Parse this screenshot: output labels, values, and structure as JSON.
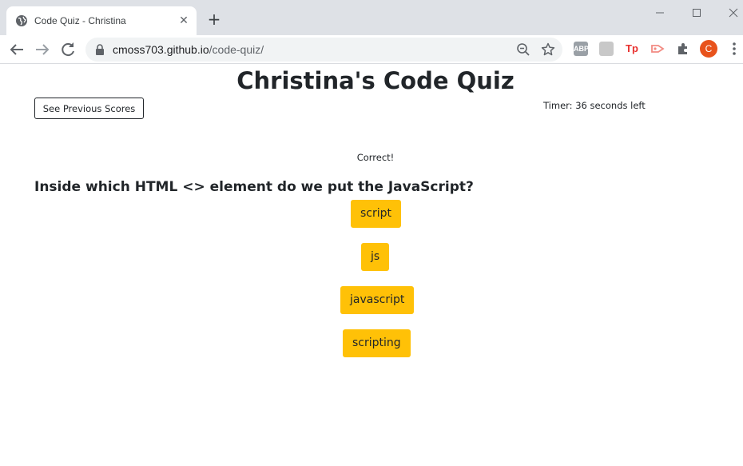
{
  "browser": {
    "tab": {
      "title": "Code Quiz - Christina",
      "close_glyph": "✕"
    },
    "new_tab_glyph": "+",
    "url": {
      "domain": "cmoss703.github.io",
      "path": "/code-quiz/"
    },
    "extensions": [
      {
        "name": "adblock-plus-icon",
        "label": "ABP"
      },
      {
        "name": "extension-icon-2",
        "label": ""
      },
      {
        "name": "tp-extension-icon",
        "label": "Tp"
      },
      {
        "name": "cast-extension-icon",
        "label": ""
      }
    ],
    "profile_initial": "C",
    "colors": {
      "tabstrip": "#dee1e6",
      "omnibox": "#f1f3f4",
      "avatar": "#e8531c"
    }
  },
  "page": {
    "title": "Christina's Code Quiz",
    "prev_scores_label": "See Previous Scores",
    "timer_text": "Timer: 36 seconds left",
    "feedback": "Correct!",
    "question": "Inside which HTML <> element do we put the JavaScript?",
    "answers": [
      "script",
      "js",
      "javascript",
      "scripting"
    ],
    "colors": {
      "answer_bg": "#ffc107",
      "text": "#212529"
    }
  }
}
